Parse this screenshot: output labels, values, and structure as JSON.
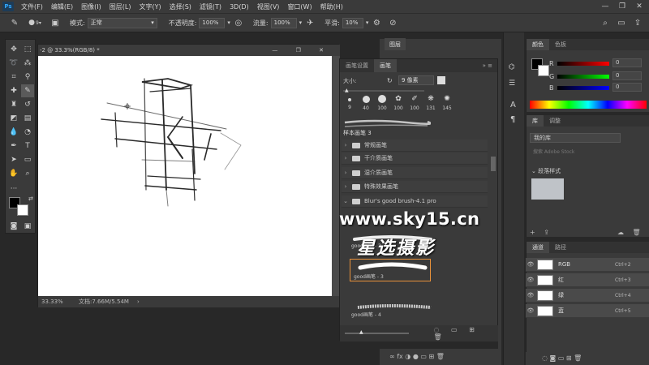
{
  "app": {
    "logo": "Ps"
  },
  "menu": [
    "文件(F)",
    "编辑(E)",
    "图像(I)",
    "图层(L)",
    "文字(Y)",
    "选择(S)",
    "滤镜(T)",
    "3D(D)",
    "视图(V)",
    "窗口(W)",
    "帮助(H)"
  ],
  "options": {
    "brush_size": "9",
    "mode_label": "模式:",
    "mode_value": "正常",
    "opacity_label": "不透明度:",
    "opacity_value": "100%",
    "flow_label": "流量:",
    "flow_value": "100%",
    "smooth_label": "平滑:",
    "smooth_value": "10%"
  },
  "document": {
    "tab_title": "-2 @ 33.3%(RGB/8) *",
    "zoom": "33.33%",
    "doc_info": "文档:7.66M/5.54M"
  },
  "brush_panel": {
    "tabs": [
      "画笔设置",
      "画笔"
    ],
    "size_label": "大小:",
    "size_value": "9 像素",
    "presets": [
      "9",
      "40",
      "100",
      "100",
      "100",
      "131",
      "145"
    ],
    "sample_label": "样本画笔 3",
    "folders": [
      "常规画笔",
      "干介质画笔",
      "湿介质画笔",
      "特殊效果画笔",
      "Blur's good brush-4.1 pro"
    ],
    "strokes": [
      "good画笔 - 2",
      "good画笔 - 3",
      "good画笔 - 4"
    ]
  },
  "layers_panel": {
    "tab": "图层"
  },
  "color_panel": {
    "tabs": [
      "颜色",
      "色板"
    ],
    "r_label": "R",
    "r_value": "0",
    "g_label": "G",
    "g_value": "0",
    "b_label": "B",
    "b_value": "0"
  },
  "library_panel": {
    "tabs": [
      "库",
      "调整"
    ],
    "library_name": "我的库",
    "search_placeholder": "搜索 Adobe Stock",
    "section": "段落样式"
  },
  "channels_panel": {
    "tabs": [
      "通道",
      "路径"
    ],
    "rows": [
      {
        "name": "RGB",
        "shortcut": "Ctrl+2"
      },
      {
        "name": "红",
        "shortcut": "Ctrl+3"
      },
      {
        "name": "绿",
        "shortcut": "Ctrl+4"
      },
      {
        "name": "蓝",
        "shortcut": "Ctrl+5"
      }
    ]
  },
  "watermark": {
    "url": "www.sky15.cn",
    "name": "星选摄影"
  },
  "colors": {
    "menubar": "#3a3a3a",
    "panel": "#3a3a3a",
    "workspace": "#282828",
    "accent": "#31a8ff",
    "selection": "#e8913a"
  }
}
